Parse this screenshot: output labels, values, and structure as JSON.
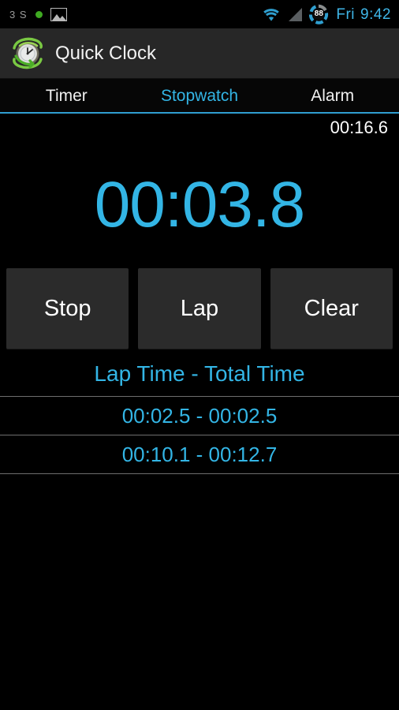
{
  "status_bar": {
    "left_text": "3 S",
    "notification_dot": "green-dot-icon",
    "image_icon": "image-icon",
    "wifi_icon": "wifi-icon",
    "signal_icon": "cell-signal-icon",
    "battery_icon": "battery-circle-icon",
    "battery_level": "88",
    "day": "Fri",
    "time": "9:42"
  },
  "action_bar": {
    "app_icon": "alarm-clock-icon",
    "title": "Quick Clock"
  },
  "tabs": [
    {
      "label": "Timer",
      "active": false
    },
    {
      "label": "Stopwatch",
      "active": true
    },
    {
      "label": "Alarm",
      "active": false
    }
  ],
  "stopwatch": {
    "total_time": "00:16.6",
    "display": "00:03.8",
    "buttons": [
      {
        "label": "Stop",
        "name": "stop-button"
      },
      {
        "label": "Lap",
        "name": "lap-button"
      },
      {
        "label": "Clear",
        "name": "clear-button"
      }
    ],
    "lap_header": "Lap Time - Total Time",
    "laps": [
      {
        "text": "00:02.5 - 00:02.5"
      },
      {
        "text": "00:10.1 - 00:12.7"
      }
    ]
  },
  "colors": {
    "accent": "#33b5e5",
    "background": "#000000",
    "action_bar": "#272727",
    "button": "#2b2b2b",
    "divider": "#6e6e6e",
    "status_green": "#3faa22"
  }
}
